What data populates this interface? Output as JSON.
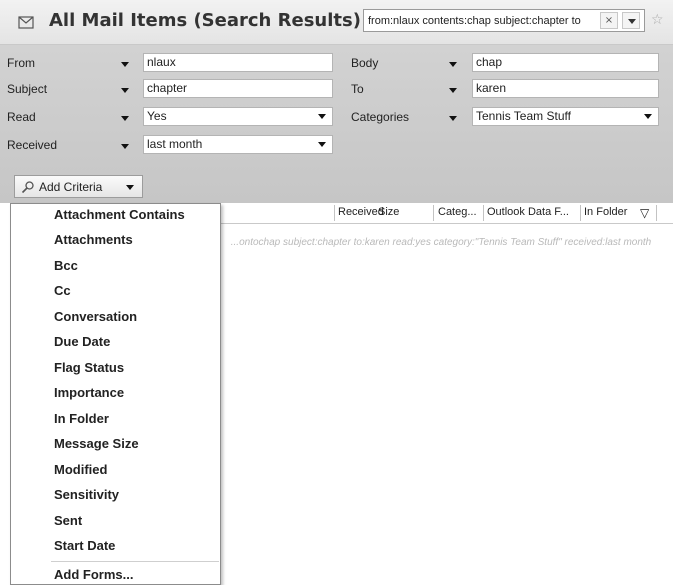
{
  "header": {
    "title": "All Mail Items (Search Results)",
    "search_value": "from:nlaux contents:chap subject:chapter to",
    "clear_glyph": "×",
    "extra_glyph": "☆"
  },
  "criteria": {
    "from": {
      "label": "From",
      "value": "nlaux"
    },
    "subject": {
      "label": "Subject",
      "value": "chapter"
    },
    "read": {
      "label": "Read",
      "value": "Yes"
    },
    "received": {
      "label": "Received",
      "value": "last month"
    },
    "body": {
      "label": "Body",
      "value": "chap"
    },
    "to": {
      "label": "To",
      "value": "karen"
    },
    "categories": {
      "label": "Categories",
      "value": "Tennis Team Stuff"
    },
    "add_criteria_label": "Add Criteria"
  },
  "columns": [
    "Received",
    "Size",
    "Categ...",
    "Outlook Data F...",
    "In Folder"
  ],
  "filter_glyph": "▽",
  "empty_message": "...ontochap subject:chapter to:karen read:yes category:\"Tennis Team Stuff\" received:last month",
  "menu": {
    "items": [
      "Attachment Contains",
      "Attachments",
      "Bcc",
      "Cc",
      "Conversation",
      "Due Date",
      "Flag Status",
      "Importance",
      "In Folder",
      "Message Size",
      "Modified",
      "Sensitivity",
      "Sent",
      "Start Date"
    ],
    "footer": "Add Forms..."
  }
}
